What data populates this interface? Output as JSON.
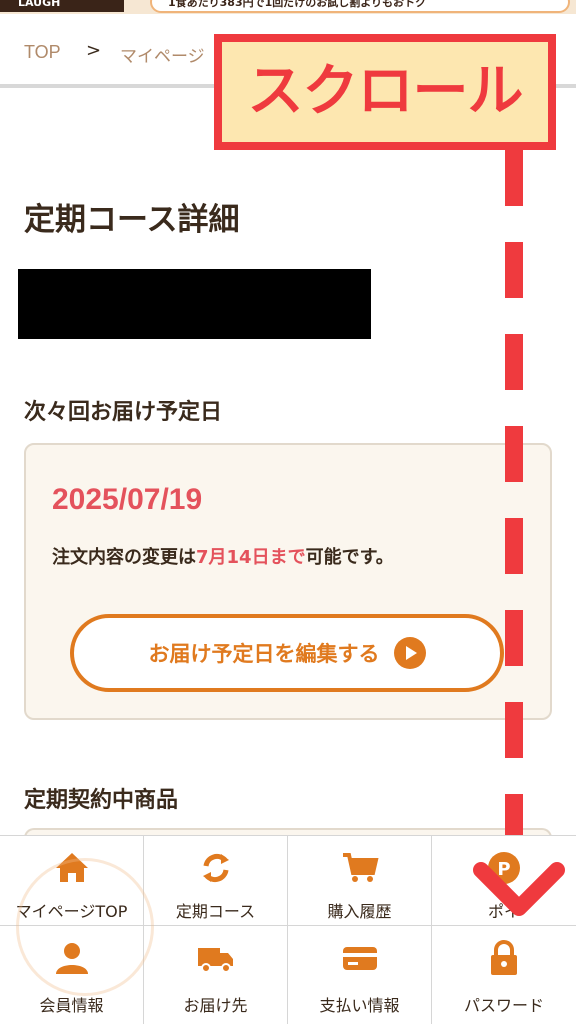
{
  "banner": {
    "tag": "LAUGH",
    "text": "1食あたり383円で1回だけのお試し割よりもおトク"
  },
  "breadcrumb": {
    "top": "TOP",
    "separator": ">",
    "mypage": "マイページ"
  },
  "overlay": {
    "label": "スクロール"
  },
  "page": {
    "title": "定期コース詳細"
  },
  "next_delivery": {
    "heading": "次々回お届け予定日",
    "date": "2025/07/19",
    "note_prefix": "注文内容の変更は",
    "note_deadline": "7月14日まで",
    "note_suffix": "可能です。",
    "edit_button": "お届け予定日を編集する"
  },
  "products": {
    "heading": "定期契約中商品"
  },
  "nav": {
    "items": [
      {
        "label": "マイページTOP",
        "icon": "home-icon"
      },
      {
        "label": "定期コース",
        "icon": "refresh-icon"
      },
      {
        "label": "購入履歴",
        "icon": "cart-icon"
      },
      {
        "label": "ポイ",
        "icon": "points-icon"
      },
      {
        "label": "会員情報",
        "icon": "user-icon"
      },
      {
        "label": "お届け先",
        "icon": "truck-icon"
      },
      {
        "label": "支払い情報",
        "icon": "credit-card-icon"
      },
      {
        "label": "パスワード",
        "icon": "lock-icon"
      }
    ]
  },
  "colors": {
    "accent": "#e07a1f",
    "highlight": "#e4525c",
    "overlay_red": "#ef3a3e",
    "card_bg": "#fbf6ee"
  }
}
